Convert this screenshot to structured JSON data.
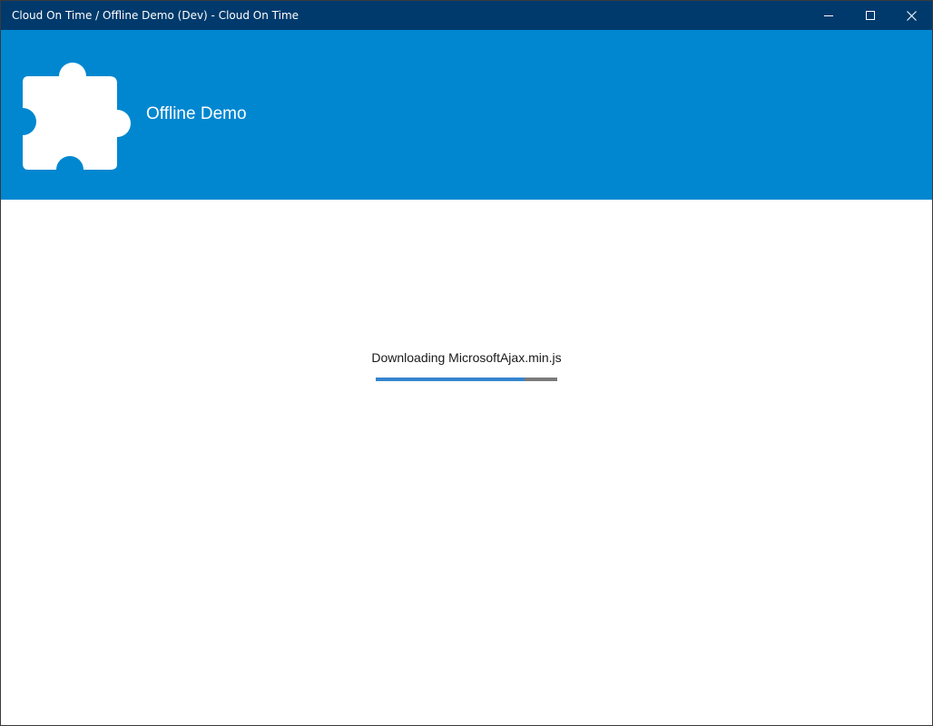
{
  "window": {
    "title": "Cloud On Time / Offline Demo (Dev) - Cloud On Time",
    "controls": {
      "minimize_icon": "minimize-icon",
      "maximize_icon": "maximize-icon",
      "close_icon": "close-icon"
    }
  },
  "header": {
    "logo_icon": "puzzle-piece-icon",
    "app_name": "Offline Demo",
    "background": "#0087d0"
  },
  "loading": {
    "status_text": "Downloading MicrosoftAjax.min.js",
    "progress_fraction": 0.82,
    "fill_color": "#3584cf",
    "track_color": "#7a7a7a"
  },
  "colors": {
    "titlebar": "#003a6c",
    "accent": "#0087d0"
  }
}
